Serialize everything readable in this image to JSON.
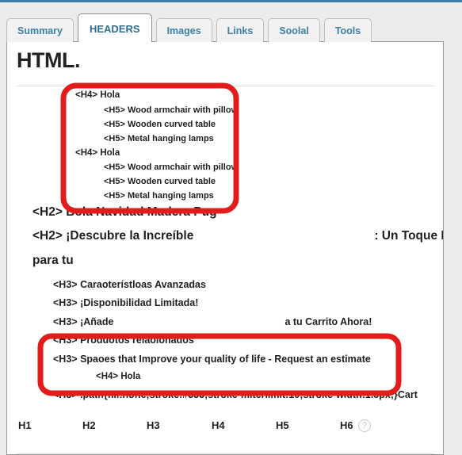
{
  "window": {
    "accent_color": "#3d7fa6",
    "panel_background": "#ffffff",
    "page_background": "#ececec",
    "annotation_color": "#e21b1b"
  },
  "tabs": [
    {
      "label": "Summary",
      "active": false
    },
    {
      "label": "HEADERS",
      "active": true
    },
    {
      "label": "Images",
      "active": false
    },
    {
      "label": "Links",
      "active": false
    },
    {
      "label": "Soolal",
      "active": false
    },
    {
      "label": "Tools",
      "active": false
    }
  ],
  "page_title": "HTML.",
  "headings": [
    {
      "tag": "<H4>",
      "text": "Hola",
      "redacted": true,
      "level": "h4"
    },
    {
      "tag": "<H5>",
      "text": "Wood armchair with pillow",
      "redacted": false,
      "level": "h5"
    },
    {
      "tag": "<H5>",
      "text": "Wooden curved table",
      "redacted": false,
      "level": "h5"
    },
    {
      "tag": "<H5>",
      "text": "Metal hanging lamps",
      "redacted": false,
      "level": "h5"
    },
    {
      "tag": "<H4>",
      "text": "Hola",
      "redacted": true,
      "level": "h4"
    },
    {
      "tag": "<H5>",
      "text": "Wood armchair with pillow",
      "redacted": false,
      "level": "h5"
    },
    {
      "tag": "<H5>",
      "text": "Wooden curved table",
      "redacted": false,
      "level": "h5"
    },
    {
      "tag": "<H5>",
      "text": "Metal hanging lamps",
      "redacted": false,
      "level": "h5"
    },
    {
      "tag": "<H2>",
      "text": "Bola Navidad Madera Pug",
      "redacted": false,
      "level": "h2"
    },
    {
      "tag": "<H2>",
      "text": "¡Descubre la Increíble",
      "text2": ": Un Toque Exclusivo",
      "text3": "para tu",
      "redacted": true,
      "level": "h2-wrap"
    },
    {
      "tag": "<H3>",
      "text": "Caraoterístloas Avanzadas",
      "redacted": false,
      "level": "h3"
    },
    {
      "tag": "<H3>",
      "text": "¡Disponibilidad Limitada!",
      "redacted": false,
      "level": "h3"
    },
    {
      "tag": "<H3>",
      "text": "¡Añade",
      "text2": "a tu Carrito Ahora!",
      "redacted": true,
      "level": "h3-split"
    },
    {
      "tag": "<H3>",
      "text": "Produotos relaolonados",
      "redacted": false,
      "level": "h3"
    },
    {
      "tag": "<H3>",
      "text": "Spaoes that Improve your quality of life - Request an estimate",
      "redacted": false,
      "level": "h3"
    },
    {
      "tag": "<H4>",
      "text": "Hola",
      "redacted": true,
      "level": "h4sub"
    },
    {
      "tag": "<H3>",
      "text": ".path{fill:none;stroke:#333;stroke-miterlimit:10;stroke-width:1.5px;}Cart",
      "redacted": false,
      "level": "h3"
    }
  ],
  "legend": {
    "items": [
      "H1",
      "H2",
      "H3",
      "H4",
      "H5",
      "H6"
    ],
    "help_label": "?"
  }
}
